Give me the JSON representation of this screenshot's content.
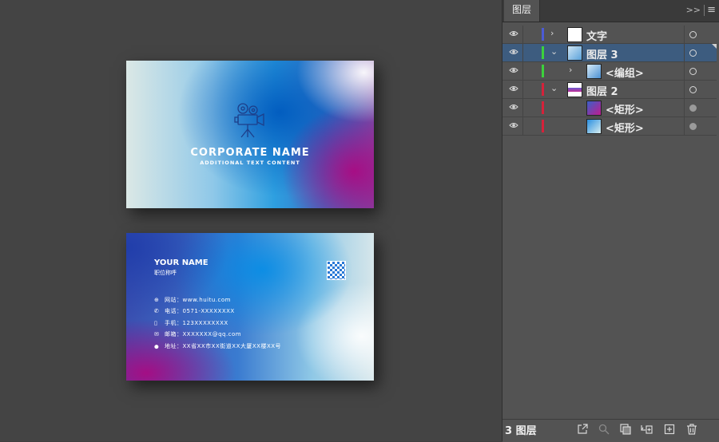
{
  "panel": {
    "tab_label": "图层",
    "collapse_glyph": ">>",
    "menu_glyph": "≡",
    "layer_count": "3 图层",
    "layers": [
      {
        "name": "文字",
        "color": "#4b5bd6",
        "expand": "›",
        "selected": false,
        "target": "empty"
      },
      {
        "name": "图层 3",
        "color": "#3cd13c",
        "expand": "⌄",
        "selected": true,
        "target": "empty"
      },
      {
        "name": "<编组>",
        "color": "#3cd13c",
        "expand": "›",
        "selected": false,
        "target": "empty"
      },
      {
        "name": "图层 2",
        "color": "#d6223a",
        "expand": "⌄",
        "selected": false,
        "target": "empty"
      },
      {
        "name": "<矩形>",
        "color": "#d6223a",
        "expand": "",
        "selected": false,
        "target": "filled"
      },
      {
        "name": "<矩形>",
        "color": "#d6223a",
        "expand": "",
        "selected": false,
        "target": "filled"
      }
    ],
    "footer_icons": [
      "export-icon",
      "search-icon",
      "clipping-mask-icon",
      "new-sublayer-icon",
      "new-layer-icon",
      "delete-icon"
    ]
  },
  "card_front": {
    "company": "CORPORATE NAME",
    "tagline": "ADDITIONAL TEXT CONTENT",
    "icon": "movie-camera-icon"
  },
  "card_back": {
    "name": "YOUR NAME",
    "title": "职位称呼",
    "contacts": [
      {
        "icon": "globe-icon",
        "glyph": "⊕",
        "text": "网站：www.huitu.com"
      },
      {
        "icon": "phone-icon",
        "glyph": "✆",
        "text": "电话：0571-XXXXXXXX"
      },
      {
        "icon": "mobile-icon",
        "glyph": "▯",
        "text": "手机：123XXXXXXXX"
      },
      {
        "icon": "mail-icon",
        "glyph": "✉",
        "text": "邮箱：XXXXXXX@qq.com"
      },
      {
        "icon": "location-icon",
        "glyph": "⬤",
        "text": "地址：XX省XX市XX街道XX大厦XX楼XX号"
      }
    ]
  },
  "colors": {
    "panel_bg": "#535353",
    "selected_row": "#3d5c7f",
    "canvas_bg": "#444444"
  }
}
